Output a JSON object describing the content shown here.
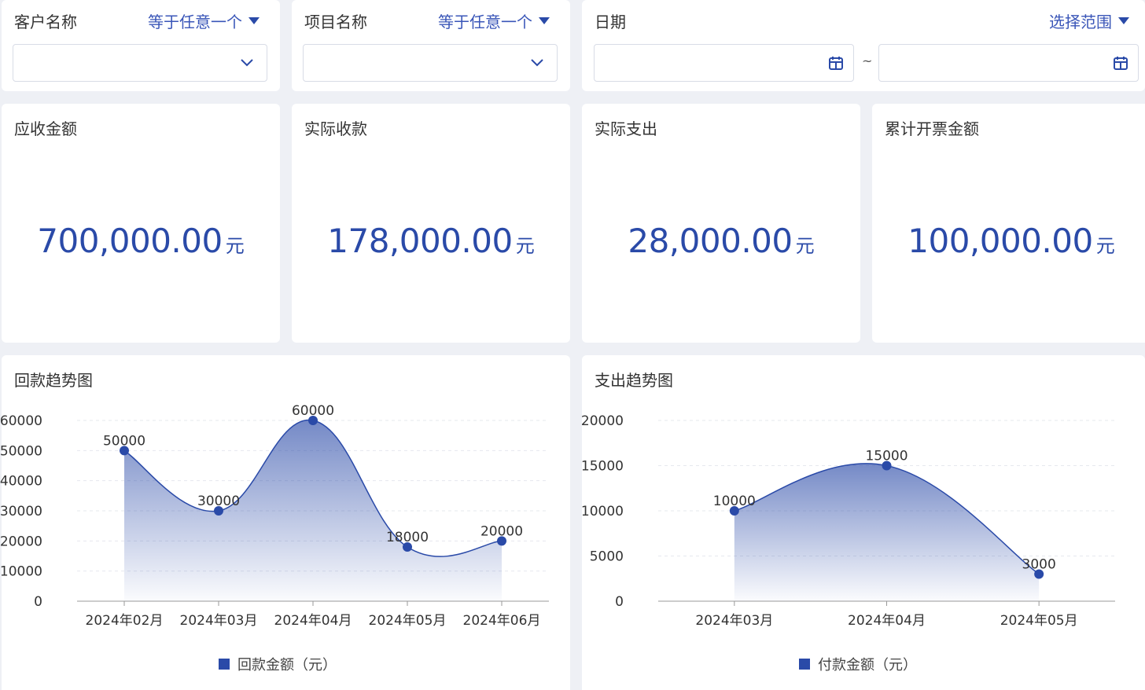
{
  "filters": [
    {
      "label": "客户名称",
      "operator": "等于任意一个",
      "value": ""
    },
    {
      "label": "项目名称",
      "operator": "等于任意一个",
      "value": ""
    },
    {
      "label": "日期",
      "operator": "选择范围",
      "start": "",
      "end": "",
      "separator": "~"
    }
  ],
  "kpis": [
    {
      "title": "应收金额",
      "value": "700,000.00",
      "unit": "元"
    },
    {
      "title": "实际收款",
      "value": "178,000.00",
      "unit": "元"
    },
    {
      "title": "实际支出",
      "value": "28,000.00",
      "unit": "元"
    },
    {
      "title": "累计开票金额",
      "value": "100,000.00",
      "unit": "元"
    }
  ],
  "charts_meta": {
    "accent": "#2a4aa8"
  },
  "chart_data": [
    {
      "type": "area",
      "title": "回款趋势图",
      "categories": [
        "2024年02月",
        "2024年03月",
        "2024年04月",
        "2024年05月",
        "2024年06月"
      ],
      "series": [
        {
          "name": "回款金额（元）",
          "values": [
            50000,
            30000,
            60000,
            18000,
            20000
          ]
        }
      ],
      "yticks": [
        0,
        10000,
        20000,
        30000,
        40000,
        50000,
        60000
      ],
      "ylim": [
        0,
        60000
      ],
      "grid": true,
      "legend": "bottom-center"
    },
    {
      "type": "area",
      "title": "支出趋势图",
      "categories": [
        "2024年03月",
        "2024年04月",
        "2024年05月"
      ],
      "series": [
        {
          "name": "付款金额（元）",
          "values": [
            10000,
            15000,
            3000
          ]
        }
      ],
      "yticks": [
        0,
        5000,
        10000,
        15000,
        20000
      ],
      "ylim": [
        0,
        20000
      ],
      "grid": true,
      "legend": "bottom-center"
    }
  ]
}
